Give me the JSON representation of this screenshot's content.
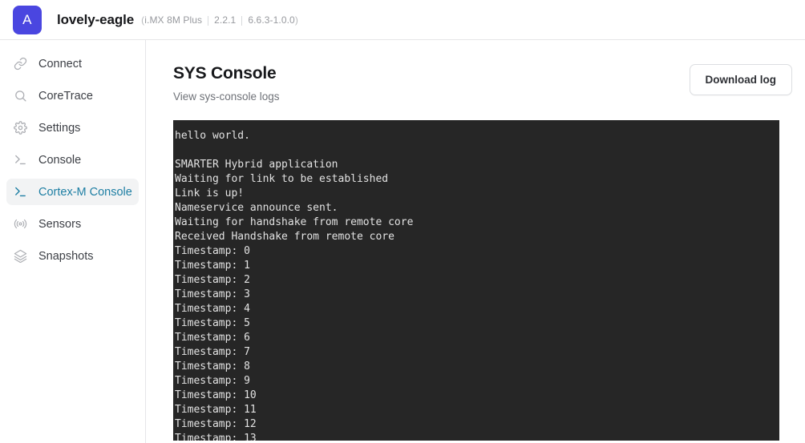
{
  "header": {
    "avatar_initial": "A",
    "device_name": "lovely-eagle",
    "paren_open": "(",
    "paren_close": ")",
    "platform": "i.MX 8M Plus",
    "version": "2.2.1",
    "kernel": "6.6.3-1.0.0",
    "avatar_color": "#4a46e0"
  },
  "sidebar": {
    "items": [
      {
        "label": "Connect",
        "icon": "link-icon",
        "active": false
      },
      {
        "label": "CoreTrace",
        "icon": "search-icon",
        "active": false
      },
      {
        "label": "Settings",
        "icon": "gear-icon",
        "active": false
      },
      {
        "label": "Console",
        "icon": "terminal-icon",
        "active": false
      },
      {
        "label": "Cortex-M Console",
        "icon": "terminal-icon",
        "active": true
      },
      {
        "label": "Sensors",
        "icon": "broadcast-icon",
        "active": false
      },
      {
        "label": "Snapshots",
        "icon": "layers-icon",
        "active": false
      }
    ],
    "active_color": "#1d7ea3",
    "active_bg": "#f2f3f4"
  },
  "main": {
    "title": "SYS Console",
    "subtitle": "View sys-console logs",
    "download_label": "Download log"
  },
  "console": {
    "background": "#262626",
    "text_color": "#e2e2e2",
    "lines": [
      "hello world.",
      "",
      "SMARTER Hybrid application",
      "Waiting for link to be established",
      "Link is up!",
      "Nameservice announce sent.",
      "Waiting for handshake from remote core",
      "Received Handshake from remote core",
      "Timestamp: 0",
      "Timestamp: 1",
      "Timestamp: 2",
      "Timestamp: 3",
      "Timestamp: 4",
      "Timestamp: 5",
      "Timestamp: 6",
      "Timestamp: 7",
      "Timestamp: 8",
      "Timestamp: 9",
      "Timestamp: 10",
      "Timestamp: 11",
      "Timestamp: 12",
      "Timestamp: 13"
    ]
  }
}
